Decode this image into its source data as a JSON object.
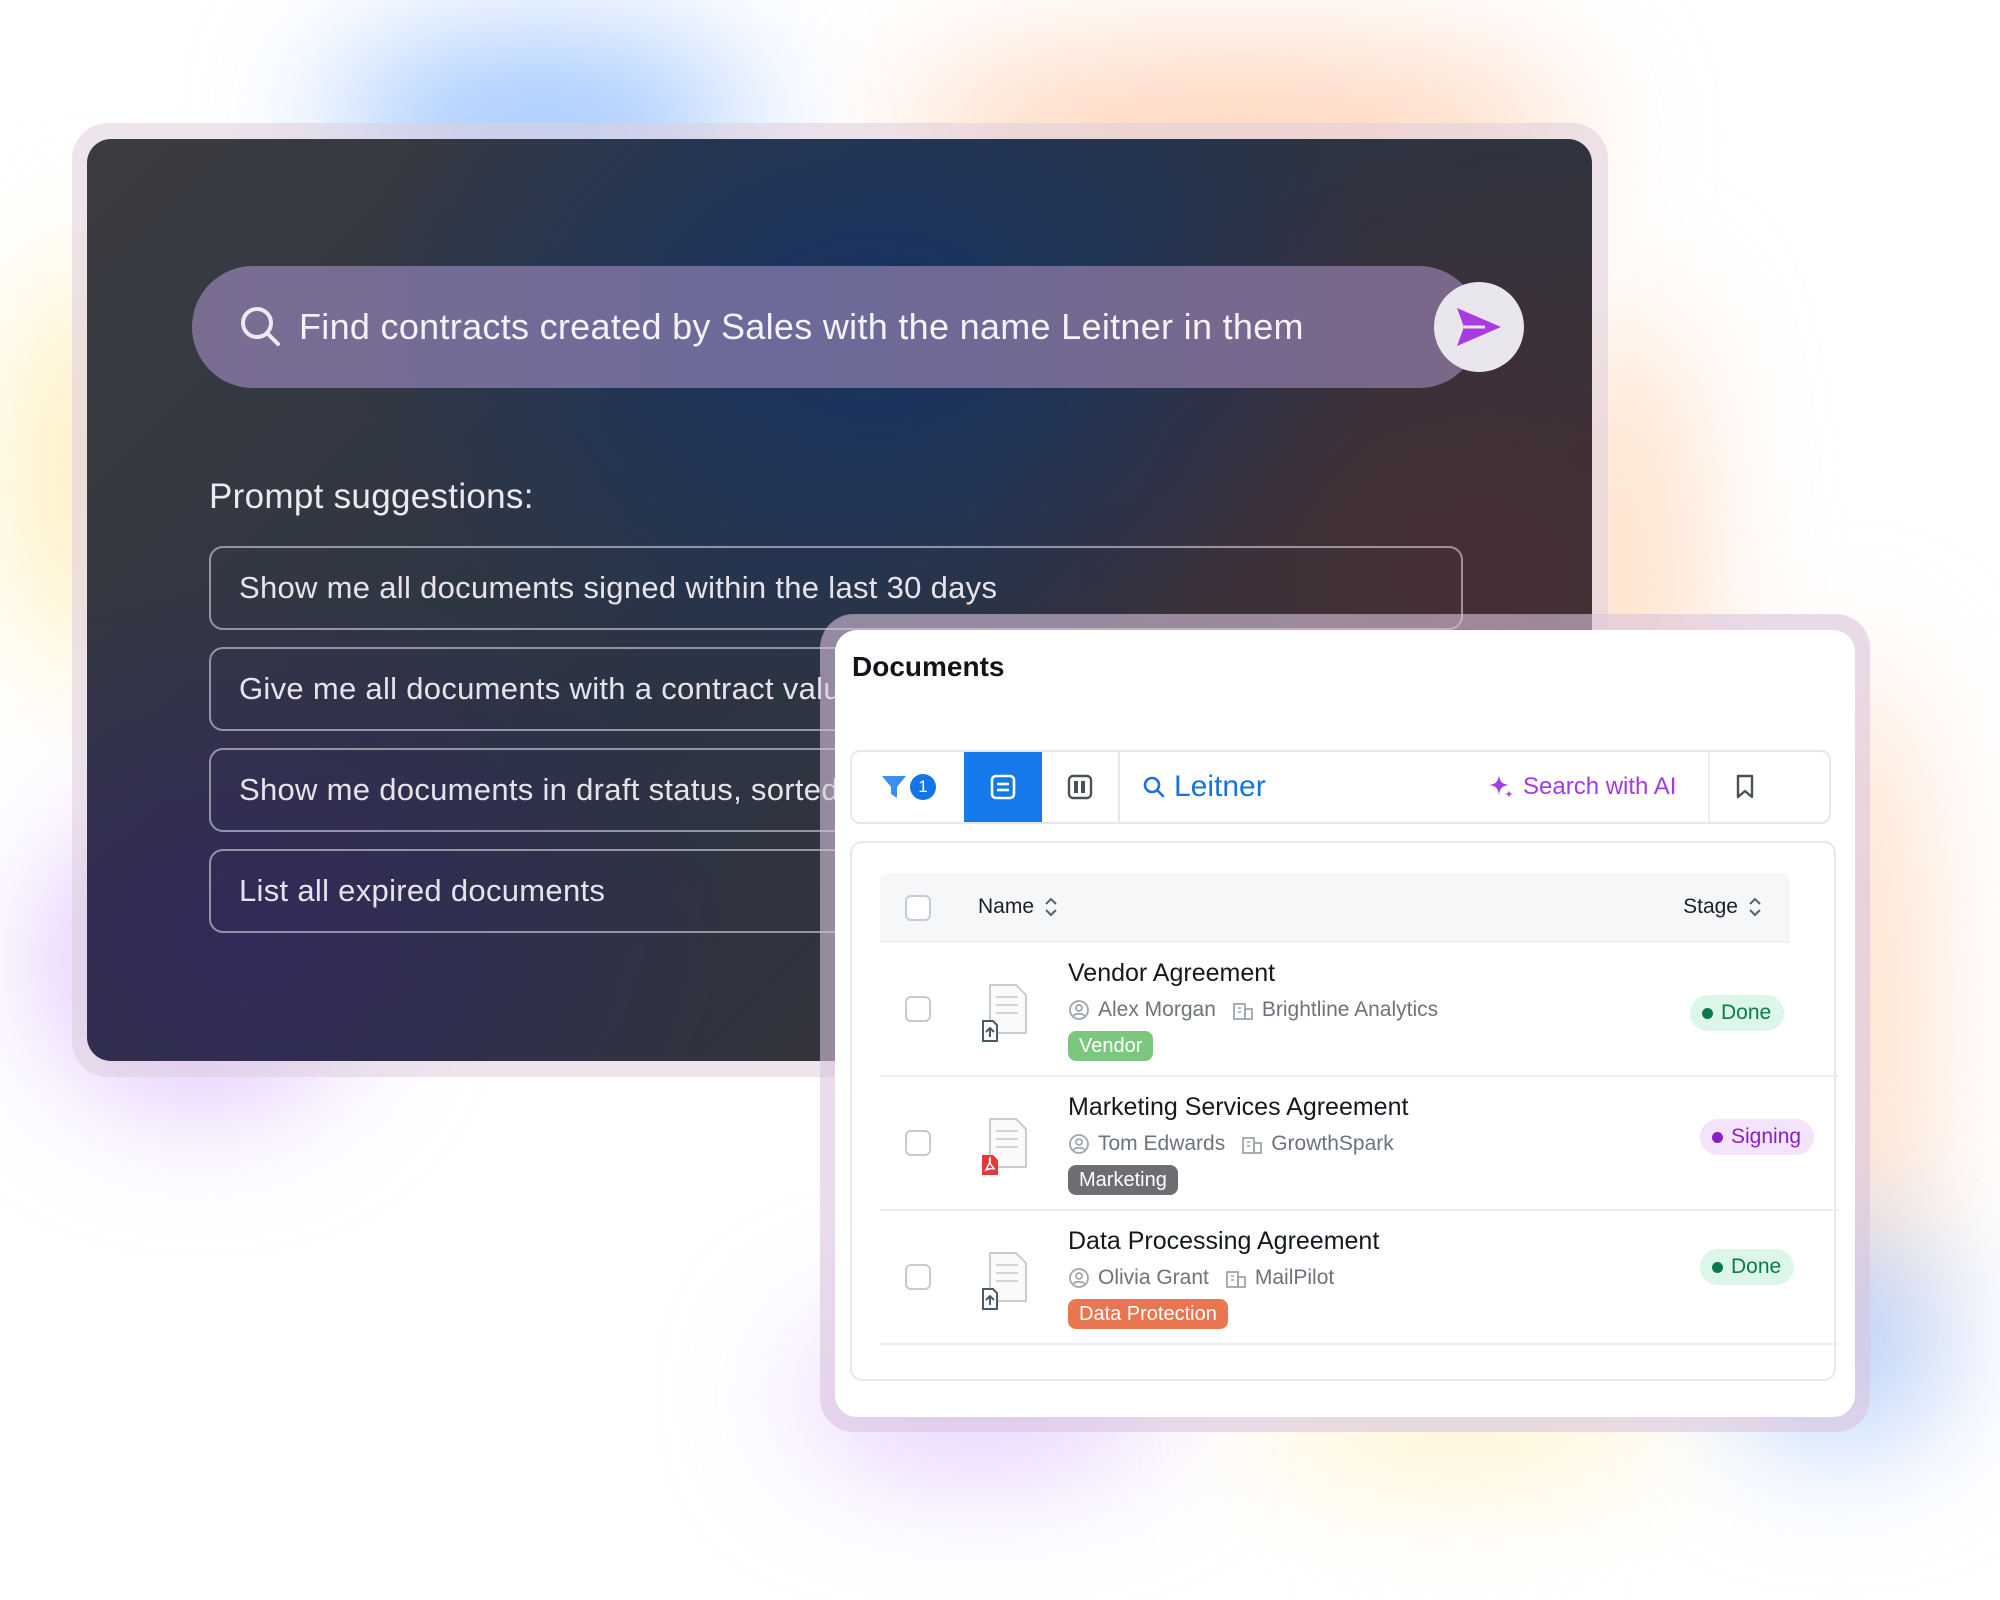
{
  "ai_search": {
    "query": "Find contracts created by Sales with the name Leitner in them",
    "prompt_title": "Prompt suggestions:",
    "suggestions": [
      "Show me all documents signed within the last 30 days",
      "Give me all documents with a contract value",
      "Show me documents in draft status, sorted",
      "List all expired documents"
    ]
  },
  "documents": {
    "title": "Documents",
    "toolbar": {
      "filter_count": "1",
      "search_value": "Leitner",
      "ai_label": "Search with AI"
    },
    "columns": {
      "name": "Name",
      "stage": "Stage"
    },
    "rows": [
      {
        "title": "Vendor Agreement",
        "owner": "Alex Morgan",
        "company": "Brightline Analytics",
        "tag": "Vendor",
        "tag_color": "#7cc77e",
        "stage": "Done",
        "file_type": "upload"
      },
      {
        "title": "Marketing Services Agreement",
        "owner": "Tom Edwards",
        "company": "GrowthSpark",
        "tag": "Marketing",
        "tag_color": "#6d6e72",
        "stage": "Signing",
        "file_type": "pdf"
      },
      {
        "title": "Data Processing Agreement",
        "owner": "Olivia Grant",
        "company": "MailPilot",
        "tag": "Data Protection",
        "tag_color": "#e9764f",
        "stage": "Done",
        "file_type": "upload"
      }
    ]
  },
  "colors": {
    "accent_blue": "#1479ea",
    "ai_purple": "#a23ae6",
    "done_bg": "#dcf7ea",
    "done_text": "#0b7a4e",
    "signing_bg": "#f3e3fb",
    "signing_text": "#8a1ec9"
  }
}
